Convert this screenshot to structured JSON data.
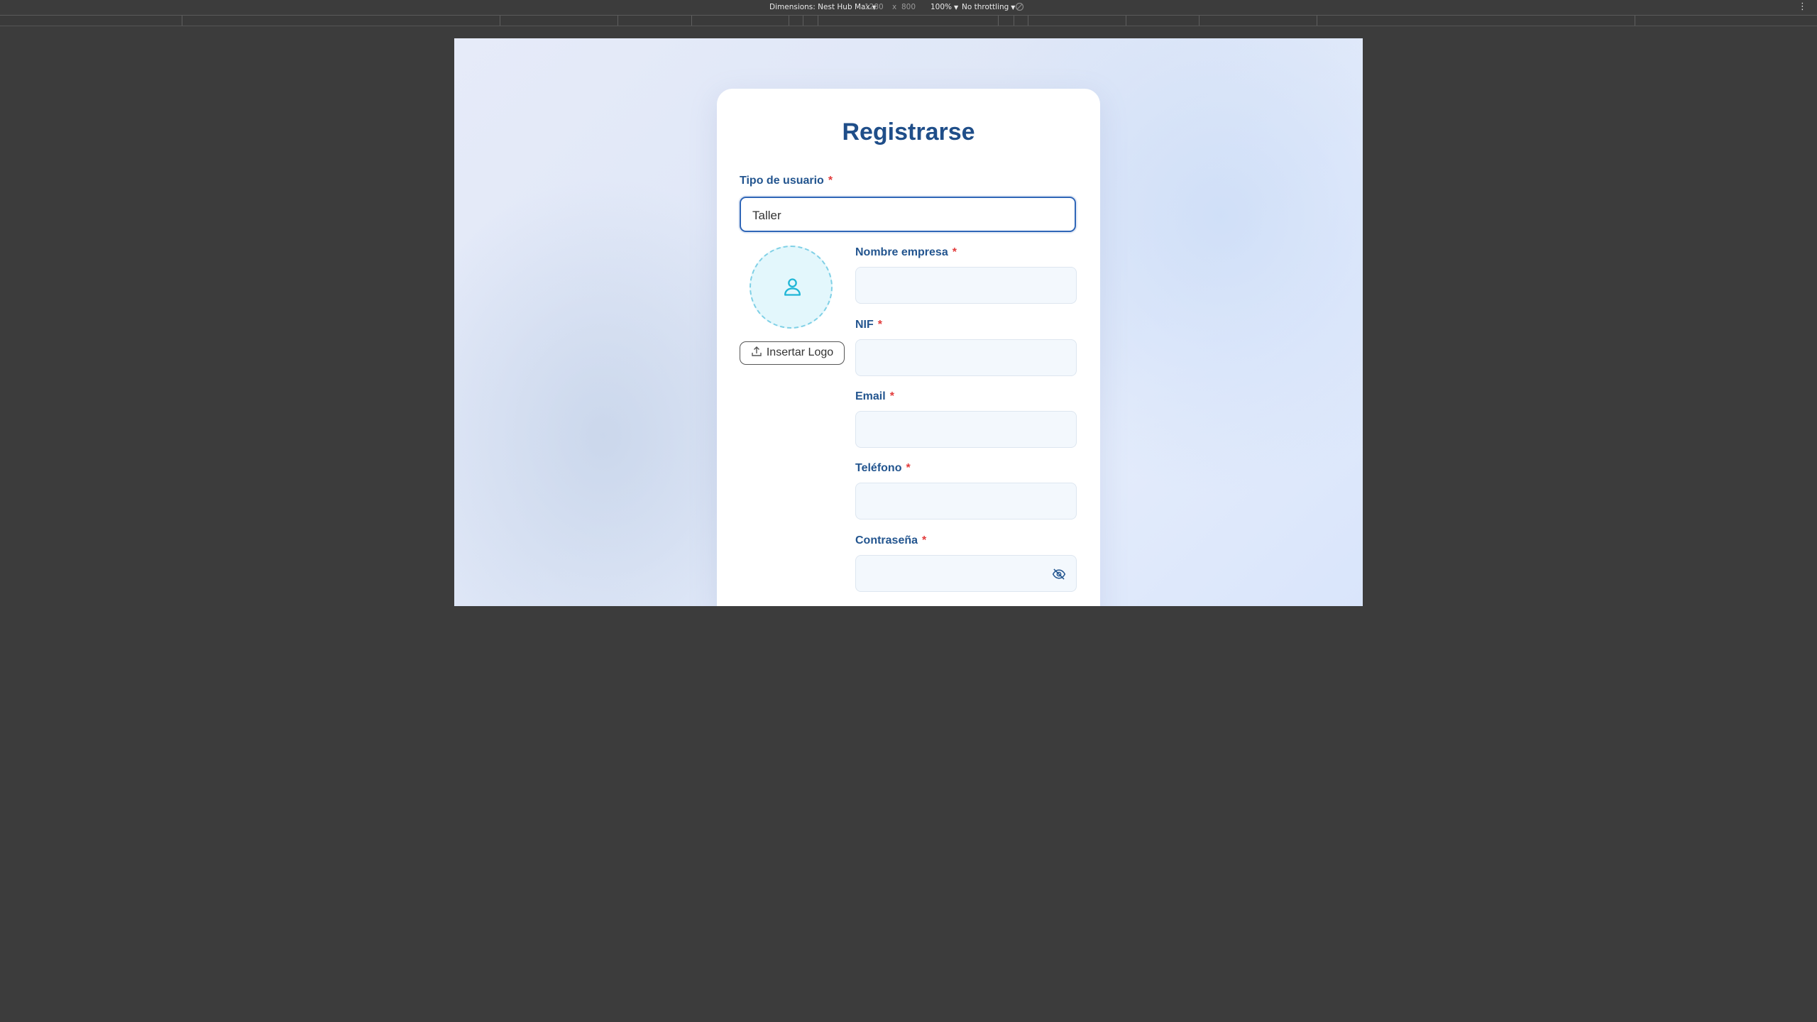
{
  "devtools": {
    "dimensions_label": "Dimensions: Nest Hub Max",
    "width_value": "1280",
    "times_symbol": "x",
    "height_value": "800",
    "zoom": "100%",
    "throttling": "No throttling"
  },
  "form": {
    "title": "Registrarse",
    "required_mark": "*",
    "user_type": {
      "label": "Tipo de usuario",
      "value": "Taller"
    },
    "logo": {
      "button_label": "Insertar Logo",
      "placeholder_icon": "user-icon"
    },
    "fields": {
      "company_name": {
        "label": "Nombre empresa",
        "value": ""
      },
      "nif": {
        "label": "NIF",
        "value": ""
      },
      "email": {
        "label": "Email",
        "value": ""
      },
      "phone": {
        "label": "Teléfono",
        "value": ""
      },
      "password": {
        "label": "Contraseña",
        "value": "",
        "toggle_icon": "eye-off-icon"
      }
    }
  },
  "colors": {
    "title": "#1f4e89",
    "label": "#23558f",
    "required": "#e23b3b",
    "focus_border": "#2f66b7",
    "avatar_accent": "#1fb6d6"
  }
}
